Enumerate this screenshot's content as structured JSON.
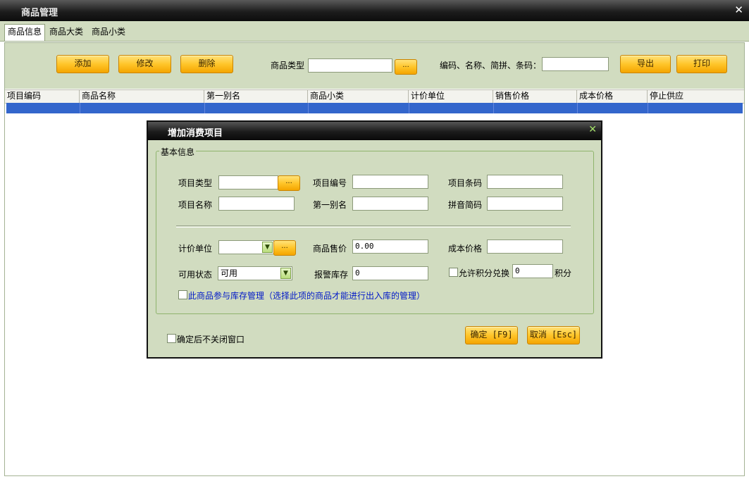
{
  "window": {
    "title": "商品管理",
    "close_glyph": "✕"
  },
  "tabs": [
    {
      "label": "商品信息"
    },
    {
      "label": "商品大类"
    },
    {
      "label": "商品小类"
    }
  ],
  "toolbar": {
    "add_label": "添加",
    "edit_label": "修改",
    "delete_label": "删除",
    "type_label": "商品类型",
    "type_value": "",
    "browse_label": "...",
    "search_label": "编码、名称、简拼、条码：",
    "search_value": "",
    "export_label": "导出",
    "print_label": "打印"
  },
  "grid": {
    "columns": [
      "项目编码",
      "商品名称",
      "第一别名",
      "商品小类",
      "计价单位",
      "销售价格",
      "成本价格",
      "停止供应"
    ]
  },
  "dialog": {
    "title": "增加消费项目",
    "close_glyph": "✕",
    "group_label": "基本信息",
    "item_type_label": "项目类型",
    "item_type_value": "",
    "browse_label": "...",
    "item_code_label": "项目编号",
    "item_code_value": "",
    "item_barcode_label": "项目条码",
    "item_barcode_value": "",
    "item_name_label": "项目名称",
    "item_name_value": "",
    "alias_label": "第一别名",
    "alias_value": "",
    "pinyin_label": "拼音简码",
    "pinyin_value": "",
    "unit_label": "计价单位",
    "unit_value": "",
    "price_label": "商品售价",
    "price_value": "0.00",
    "cost_label": "成本价格",
    "cost_value": "",
    "status_label": "可用状态",
    "status_value": "可用",
    "alarm_label": "报警库存",
    "alarm_value": "0",
    "points_label": "允许积分兑换",
    "points_value": "0",
    "points_unit": "积分",
    "inventory_label": "此商品参与库存管理（选择此项的商品才能进行出入库的管理）",
    "keep_open_label": "确定后不关闭窗口",
    "ok_label": "确定 [F9]",
    "cancel_label": "取消 [Esc]"
  },
  "colors": {
    "accent_orange": "#ffc52a",
    "panel_green": "#d1dcc0",
    "selection_blue": "#3366cc"
  }
}
